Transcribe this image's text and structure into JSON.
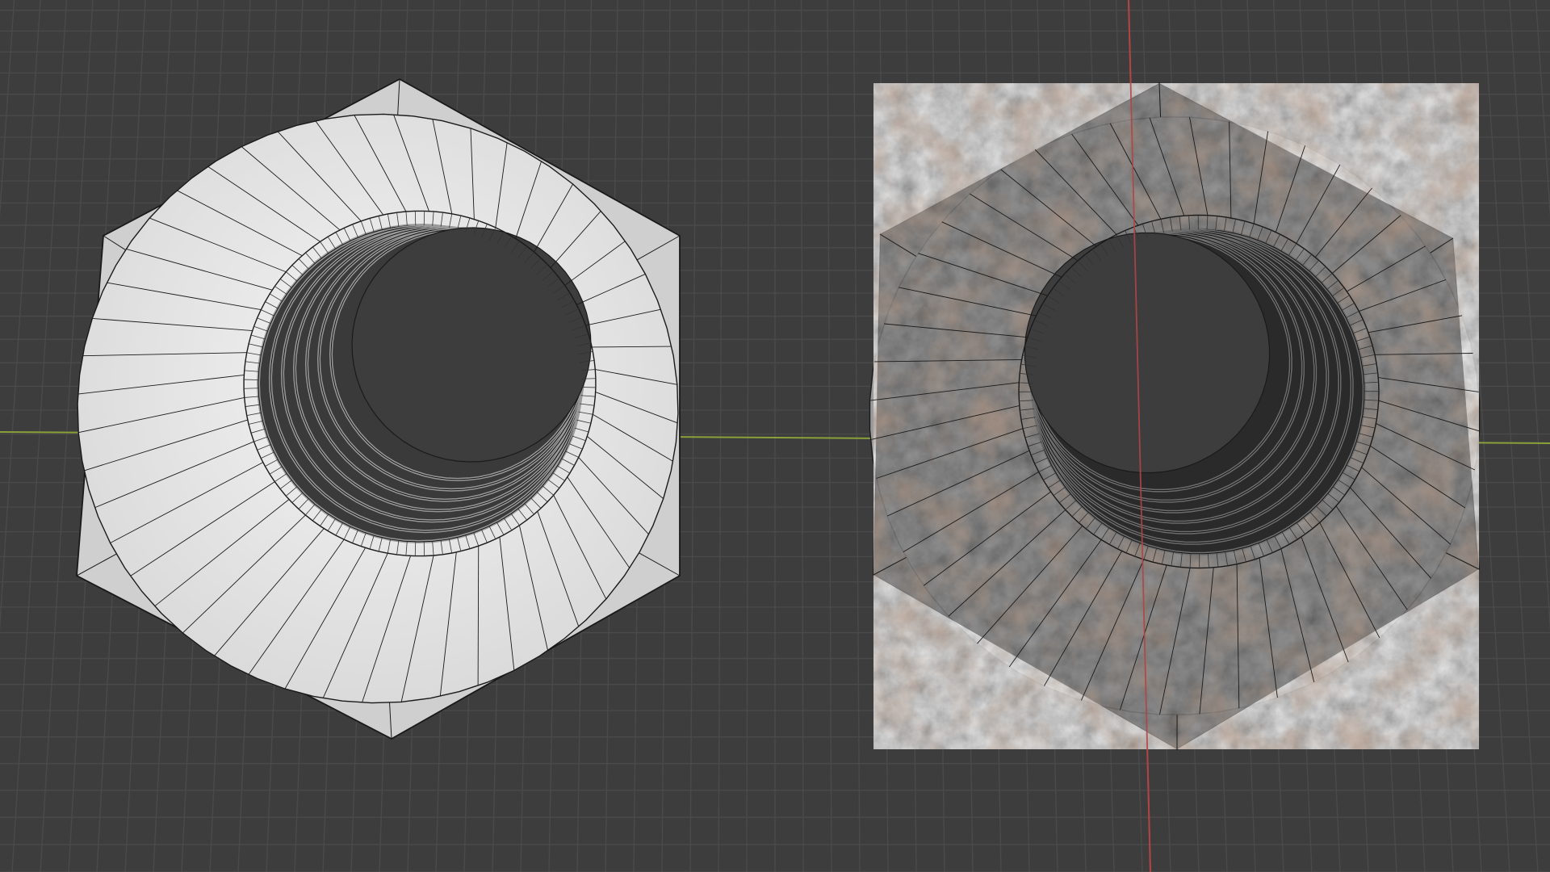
{
  "viewport": {
    "background_color": "#3d3d3d",
    "grid": {
      "visible": true,
      "color": "#4a4a4a"
    },
    "axes": {
      "x_axis": {
        "color": "#8aa03a",
        "visible": true
      },
      "y_axis": {
        "color": "#b04545",
        "visible": true
      }
    }
  },
  "objects": [
    {
      "name": "hex-nut-solid-wireframe",
      "shading": "solid",
      "wireframe_overlay": true,
      "color": "#e3e3e3"
    },
    {
      "name": "hex-nut-textured-wireframe",
      "shading": "material-preview",
      "wireframe_overlay": true,
      "color": "#8e8e8e",
      "texture": "weathered-rusted-metal"
    }
  ]
}
